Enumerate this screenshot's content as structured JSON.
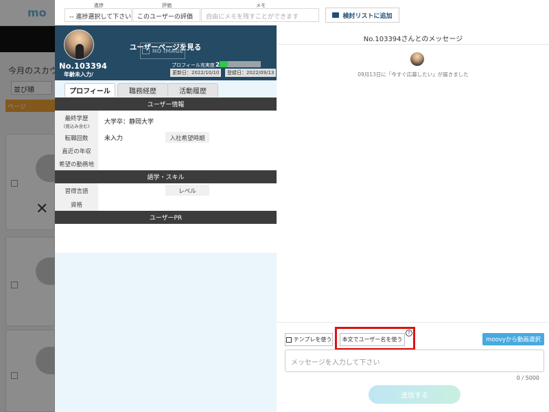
{
  "background": {
    "logo": "mo",
    "scout_title": "今月のスカウ",
    "sort_label": "並び順",
    "page_label": "ページ"
  },
  "toolbar": {
    "progress_label": "進捗",
    "progress_value": "-- 進捗選択して下さい --",
    "rating_label": "評価",
    "rating_value": "このユーザーの評価",
    "memo_label": "メモ",
    "memo_placeholder": "自由にメモを残すことができます",
    "add_list_label": "検討リストに追加"
  },
  "profile": {
    "view_user_label": "ユーザーページを見る",
    "no_image_label": "NO IMAGE",
    "user_no": "No.103394",
    "age": "年齢未入力/",
    "completeness_label": "プロフィール充実度",
    "completeness_value": "20",
    "completeness_fraction": 0.2,
    "updated": "更新日：2022/10/10",
    "registered": "登録日：2022/09/13",
    "tabs": [
      "プロフィール",
      "職務経歴",
      "活動履歴"
    ],
    "user_info_title": "ユーザー情報",
    "education_label": "最終学歴",
    "education_note": "(見込み含む)",
    "education_value": "大学卒：静岡大学",
    "job_changes_label": "転職回数",
    "job_changes_value": "未入力",
    "join_timing_label": "入社希望時期",
    "recent_income_label": "直近の年収",
    "desired_location_label": "希望の勤務地",
    "skills_title": "語学・スキル",
    "language_label": "習得言語",
    "level_label": "レベル",
    "qualification_label": "資格",
    "pr_title": "ユーザーPR"
  },
  "messages": {
    "title": "No.103394さんとのメッセージ",
    "notice": "09月13日に「今すぐ応募したい」が届きました",
    "template_button": "テンプレを使う",
    "username_button": "本文でユーザー名を使う",
    "help_mark": "?",
    "moovy_button": "moovyから動画選択",
    "input_placeholder": "メッセージを入力して下さい",
    "counter": "0 / 5000",
    "send_button": "送信する"
  }
}
